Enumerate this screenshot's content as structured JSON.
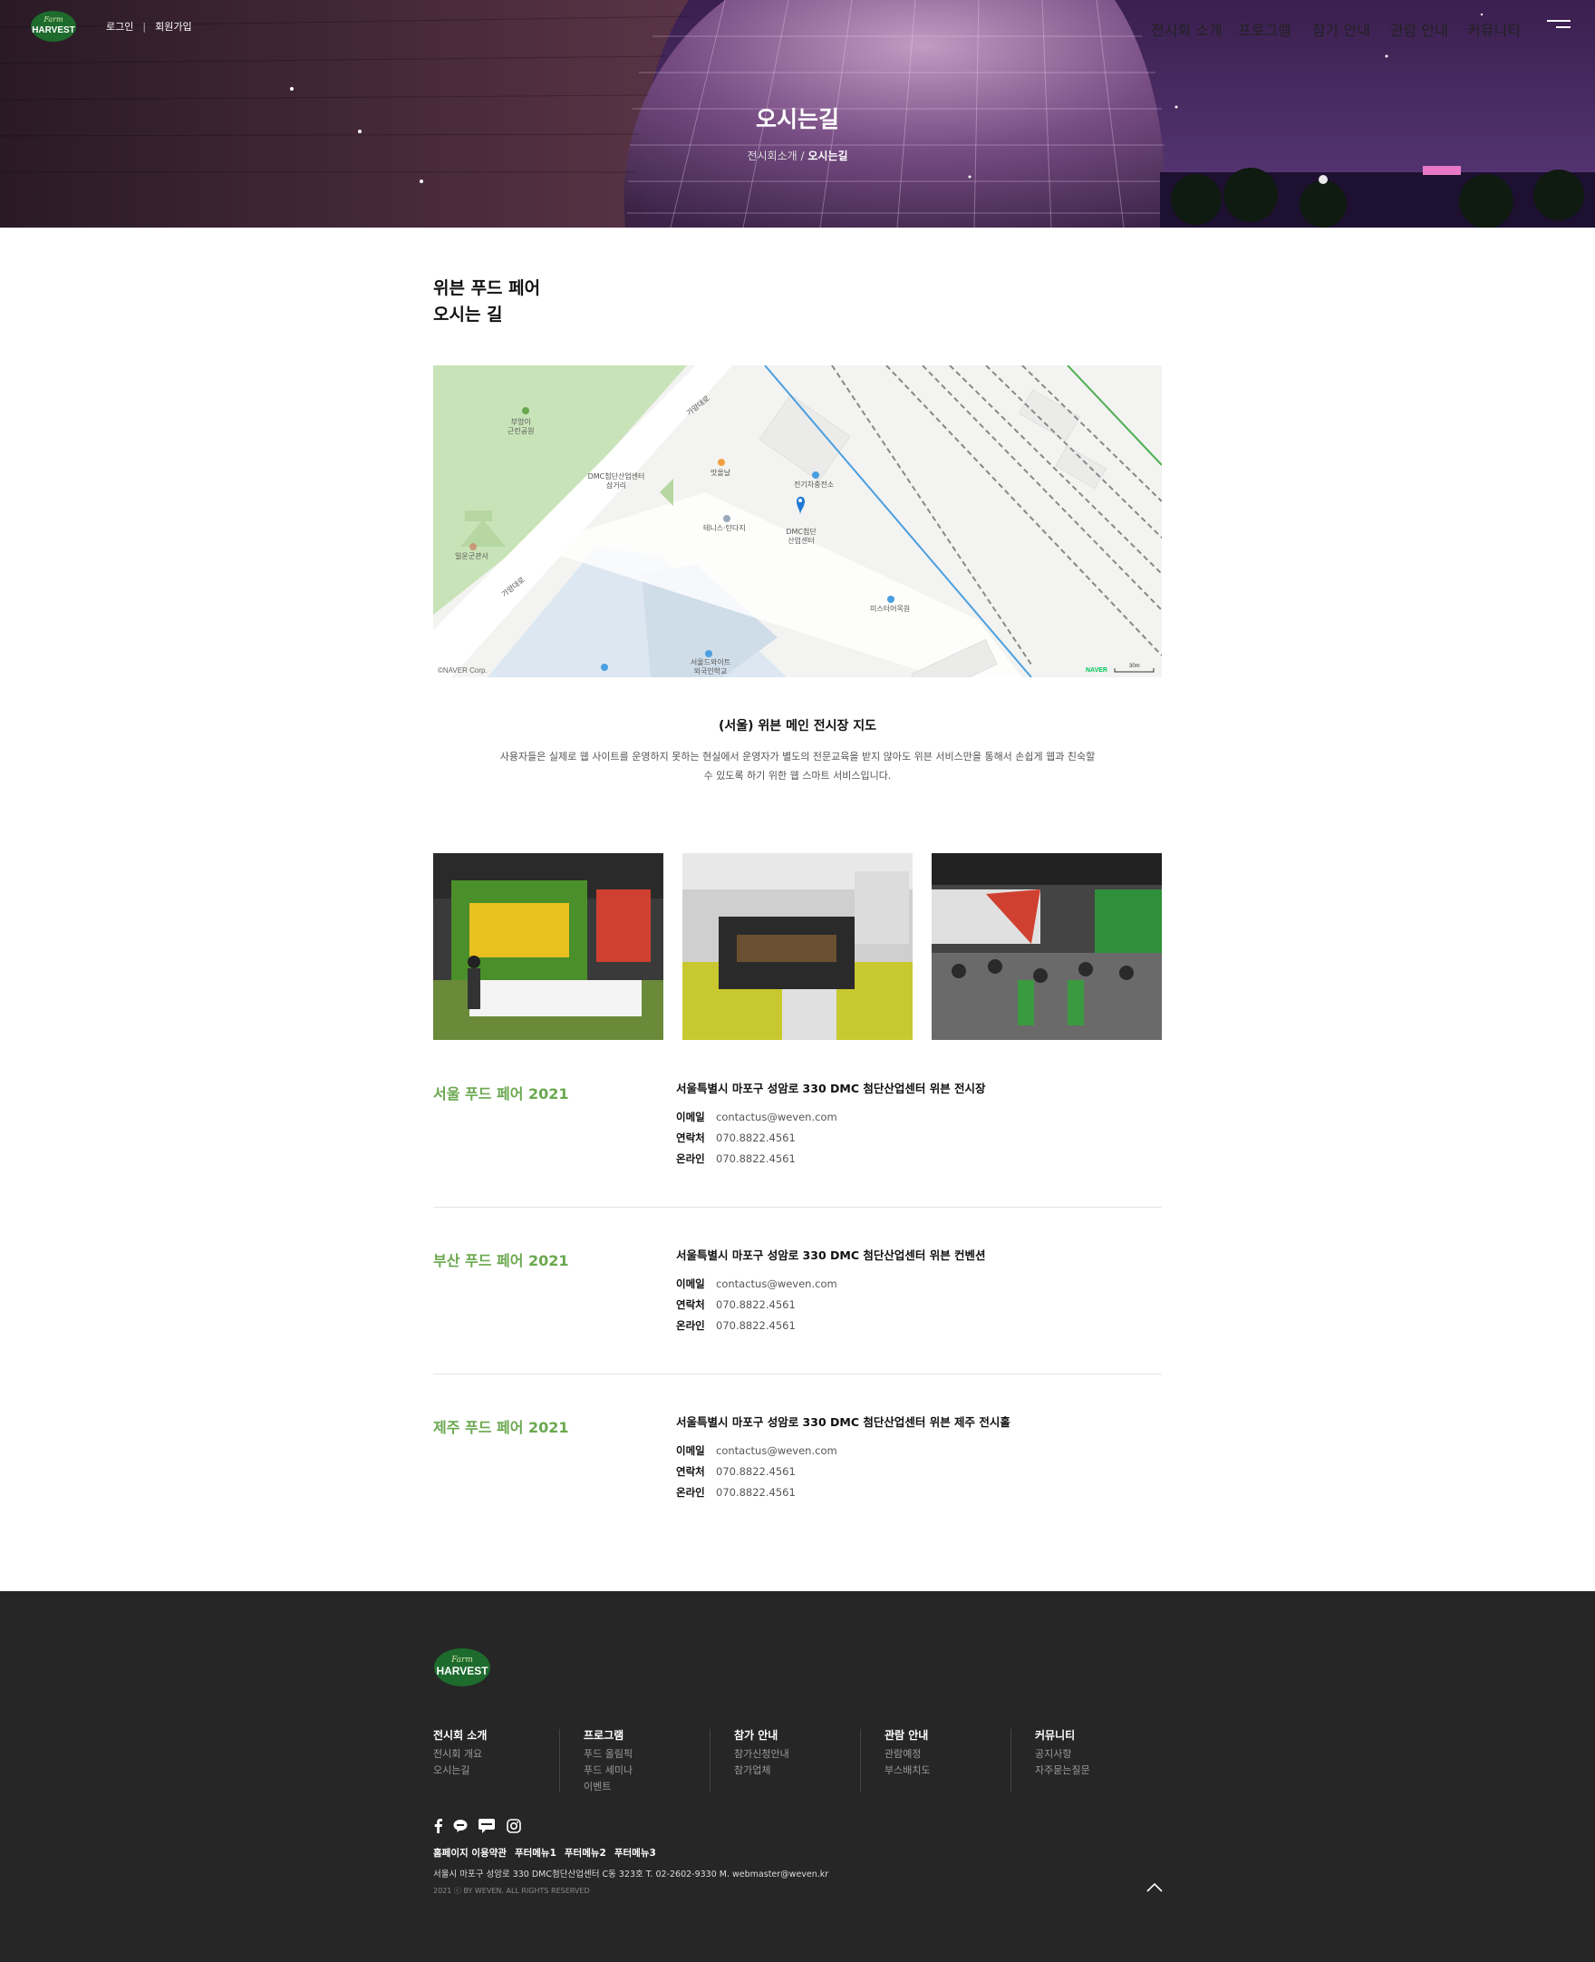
{
  "brand": {
    "logo_top": "Farm",
    "logo_main": "HARVEST"
  },
  "topbar": {
    "login": "로그인",
    "signup": "회원가입"
  },
  "nav": [
    "전시회 소개",
    "프로그램",
    "참가 안내",
    "관람 안내",
    "커뮤니티"
  ],
  "hero": {
    "title": "오시는길",
    "crumb_prev": "전시회소개",
    "crumb_sep": "/",
    "crumb_current": "오시는길"
  },
  "page": {
    "heading_line1": "위븐 푸드 페어",
    "heading_line2": "오시는 길"
  },
  "map": {
    "labels": {
      "park": "부엉이\n근린공원",
      "crossroad": "DMC첨단산업센터\n삼거리",
      "restaurant": "맛올날",
      "ev": "전기차충전소",
      "center": "DMC첨단\n산업센터",
      "tennis": "테니스·탄다지",
      "temple": "일운군관사",
      "museum": "미스터어목원",
      "school": "서울드와이트\n외국인학교",
      "road1": "가양대로",
      "road2": "가양대로",
      "copyright": "©NAVER Corp.",
      "naver": "NAVER",
      "scale": "30m"
    }
  },
  "caption": {
    "title": "(서울) 위븐 메인 전시장 지도",
    "desc": "사용자들은 실제로 웹 사이트를 운영하지 못하는 현실에서 운영자가 별도의 전문교육을 받지 않아도 위븐 서비스만을 통해서 손쉽게 웹과 친숙할 수 있도록 하기 위한 웹 스마트 서비스입니다."
  },
  "photos": [
    "food-booth-photo",
    "exhibition-hall-photo",
    "crowd-booth-photo"
  ],
  "venues": [
    {
      "name": "서울 푸드 페어 2021",
      "address": "서울특별시 마포구 성암로 330 DMC 첨단산업센터 위븐 전시장",
      "email_label": "이메일",
      "email": "contactus@weven.com",
      "phone_label": "연락처",
      "phone": "070.8822.4561",
      "online_label": "온라인",
      "online": "070.8822.4561"
    },
    {
      "name": "부산 푸드 페어 2021",
      "address": "서울특별시 마포구 성암로 330 DMC 첨단산업센터 위븐 컨벤션",
      "email_label": "이메일",
      "email": "contactus@weven.com",
      "phone_label": "연락처",
      "phone": "070.8822.4561",
      "online_label": "온라인",
      "online": "070.8822.4561"
    },
    {
      "name": "제주 푸드 페어 2021",
      "address": "서울특별시 마포구 성암로 330 DMC 첨단산업센터 위븐 제주 전시홀",
      "email_label": "이메일",
      "email": "contactus@weven.com",
      "phone_label": "연락처",
      "phone": "070.8822.4561",
      "online_label": "온라인",
      "online": "070.8822.4561"
    }
  ],
  "footer": {
    "columns": [
      {
        "title": "전시회 소개",
        "items": [
          "전시회 개요",
          "오시는길"
        ]
      },
      {
        "title": "프로그램",
        "items": [
          "푸드 올림픽",
          "푸드 세미나",
          "이벤트"
        ]
      },
      {
        "title": "참가 안내",
        "items": [
          "참가신청안내",
          "참가업체"
        ]
      },
      {
        "title": "관람 안내",
        "items": [
          "관람예정",
          "부스배치도"
        ]
      },
      {
        "title": "커뮤니티",
        "items": [
          "공지사항",
          "자주묻는질문"
        ]
      }
    ],
    "social": [
      "facebook-icon",
      "line-icon",
      "talk-icon",
      "instagram-icon"
    ],
    "links": [
      "홈페이지 이용약관",
      "푸터메뉴1",
      "푸터메뉴2",
      "푸터메뉴3"
    ],
    "address": "서울시 마포구 성암로 330 DMC첨단산업센터 C동 323호 T. 02-2602-9330 M. webmaster@weven.kr",
    "copyright": "2021 ⓒ BY WEVEN. ALL RIGHTS RESERVED"
  },
  "colors": {
    "accent": "#6aa84f",
    "footer_bg": "#262626",
    "hero_purple": "#4c2a5a",
    "map_river": "#4a9fe0"
  }
}
